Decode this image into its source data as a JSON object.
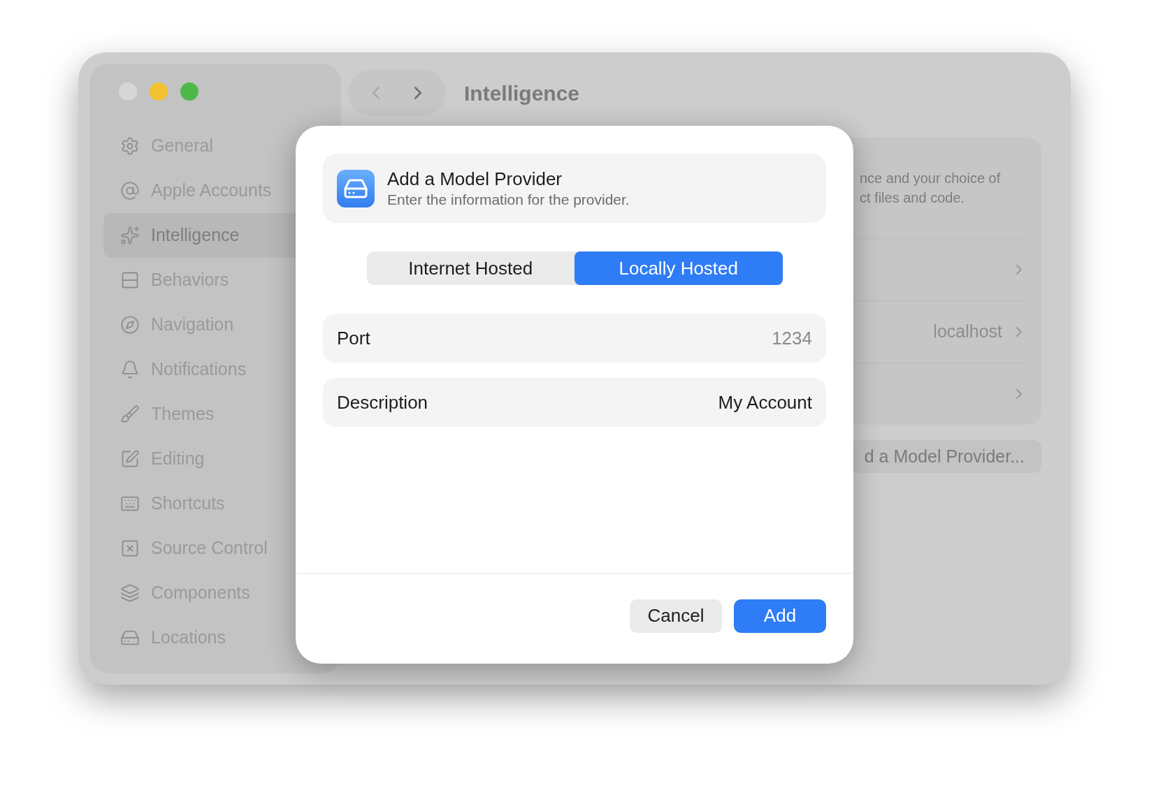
{
  "window": {
    "title": "Intelligence"
  },
  "sidebar": {
    "items": [
      {
        "label": "General",
        "selected": false
      },
      {
        "label": "Apple Accounts",
        "selected": false
      },
      {
        "label": "Intelligence",
        "selected": true
      },
      {
        "label": "Behaviors",
        "selected": false
      },
      {
        "label": "Navigation",
        "selected": false
      },
      {
        "label": "Notifications",
        "selected": false
      },
      {
        "label": "Themes",
        "selected": false
      },
      {
        "label": "Editing",
        "selected": false
      },
      {
        "label": "Shortcuts",
        "selected": false
      },
      {
        "label": "Source Control",
        "selected": false
      },
      {
        "label": "Components",
        "selected": false
      },
      {
        "label": "Locations",
        "selected": false
      }
    ]
  },
  "content": {
    "description_lines": [
      "nce and your choice of",
      "ct files and code."
    ],
    "rows": [
      {
        "value": ""
      },
      {
        "value": "localhost"
      },
      {
        "value": ""
      }
    ],
    "add_button": "d a Model Provider..."
  },
  "dialog": {
    "title": "Add a Model Provider",
    "subtitle": "Enter the information for the provider.",
    "segments": [
      {
        "label": "Internet Hosted",
        "selected": false
      },
      {
        "label": "Locally Hosted",
        "selected": true
      }
    ],
    "fields": [
      {
        "label": "Port",
        "placeholder": "1234"
      },
      {
        "label": "Description",
        "value": "My Account"
      }
    ],
    "buttons": [
      {
        "label": "Cancel",
        "kind": "secondary"
      },
      {
        "label": "Add",
        "kind": "primary"
      }
    ]
  }
}
